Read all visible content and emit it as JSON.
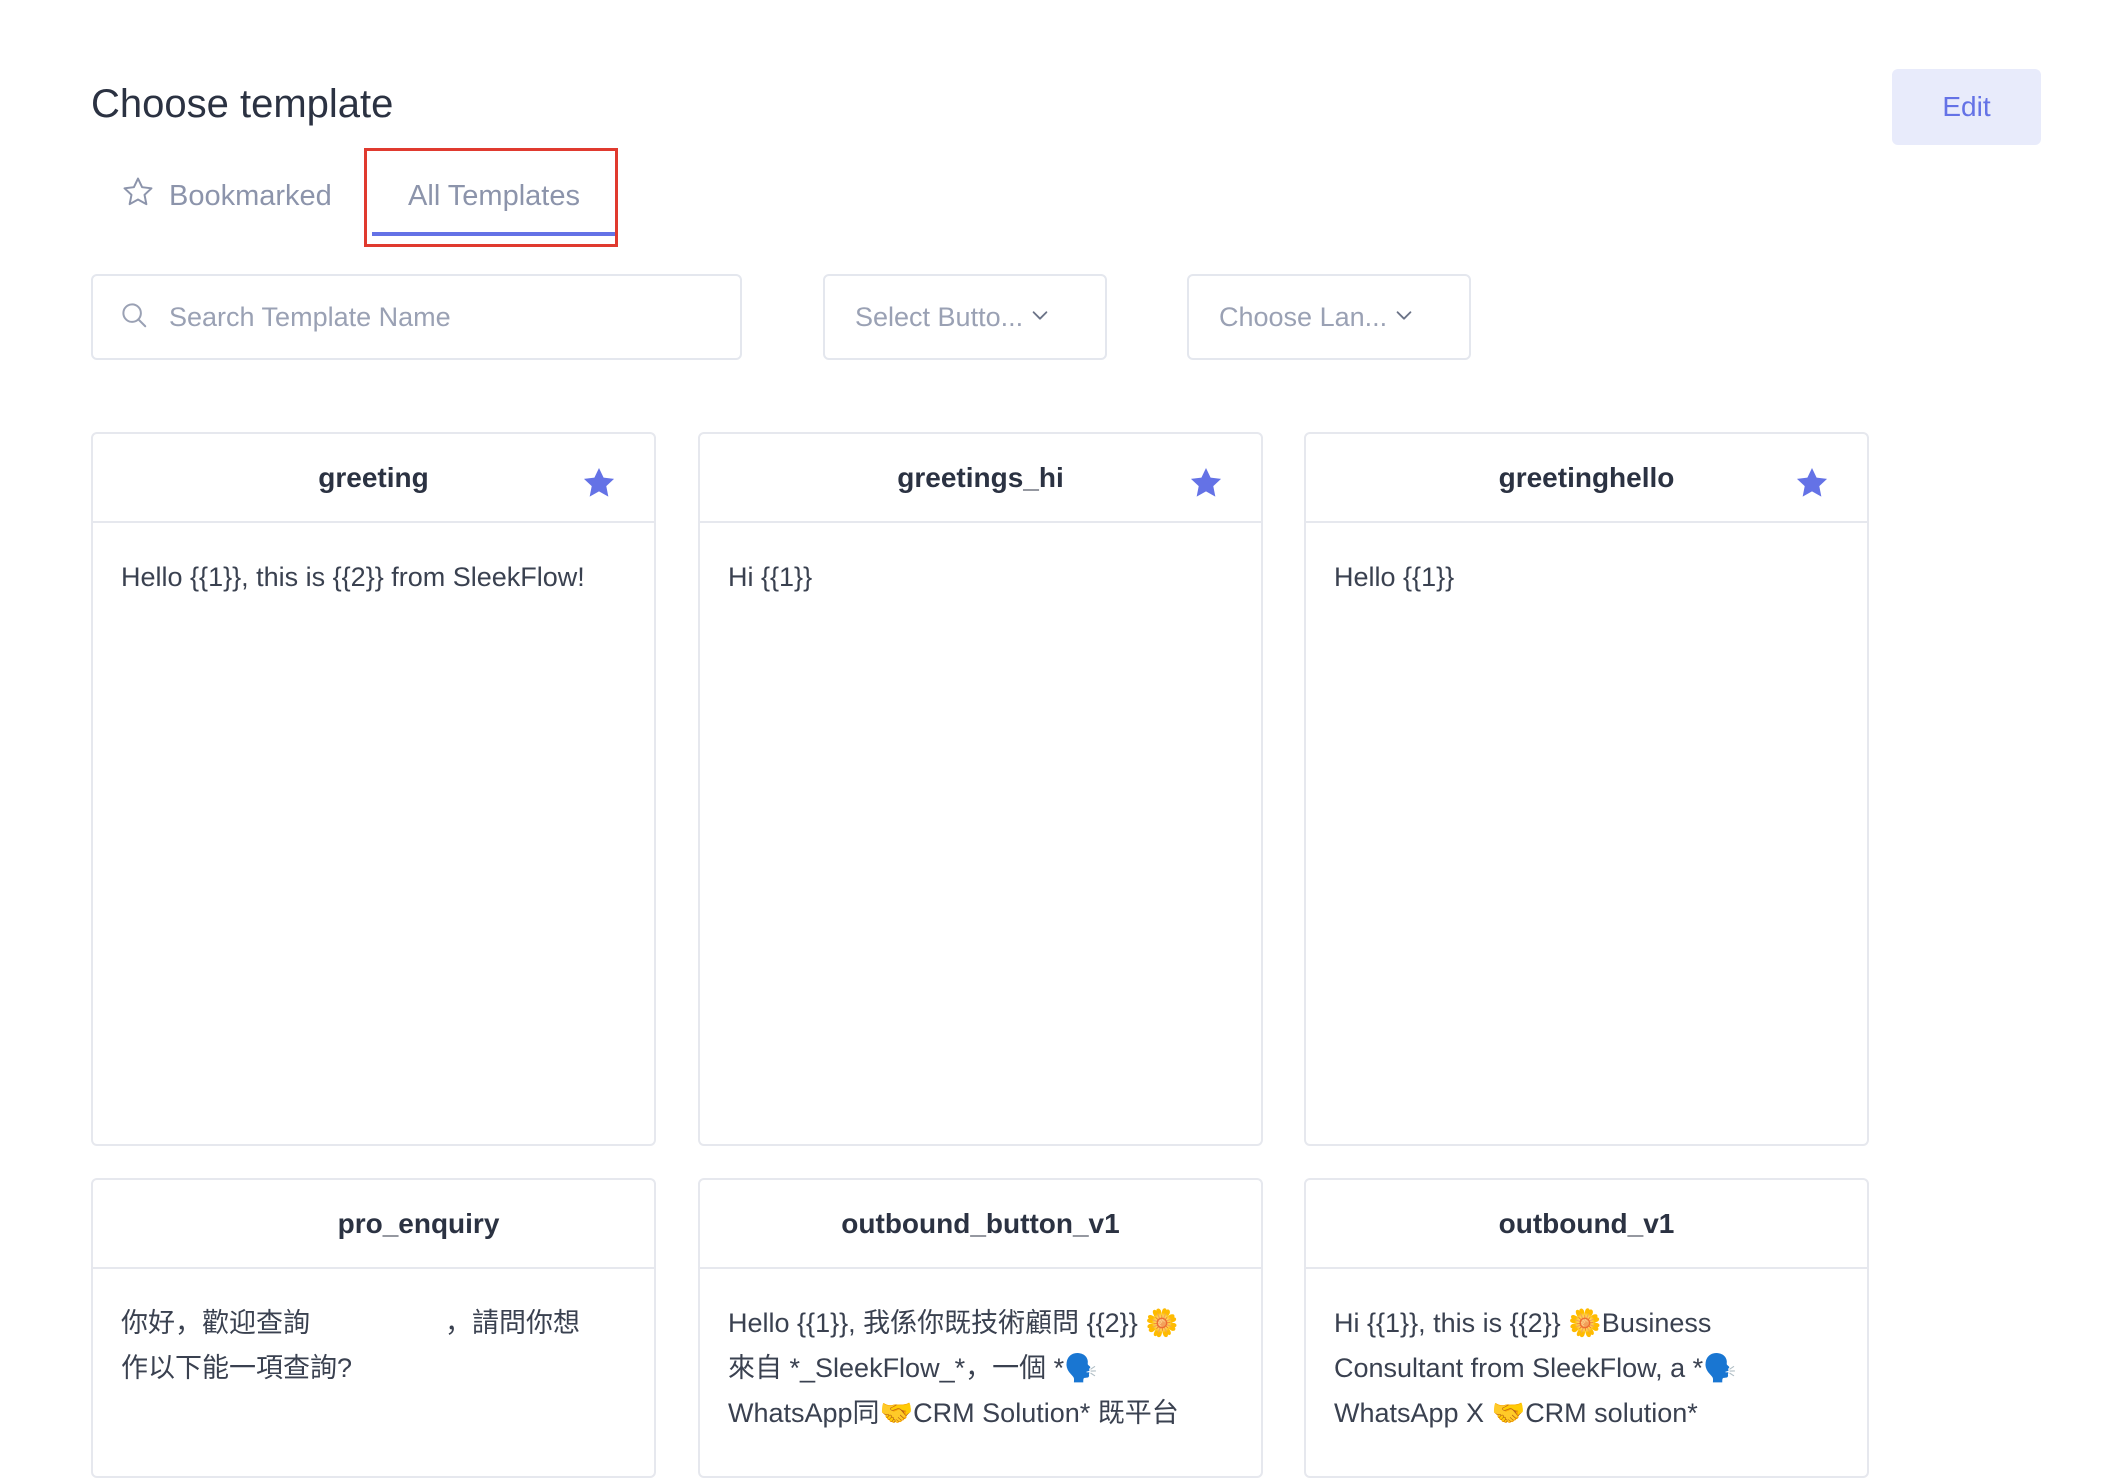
{
  "page": {
    "title": "Choose template",
    "edit_label": "Edit"
  },
  "tabs": [
    {
      "label": "Bookmarked",
      "icon": "star-outline-icon",
      "active": false
    },
    {
      "label": "All Templates",
      "active": true
    }
  ],
  "filters": {
    "search_placeholder": "Search Template Name",
    "button_select": "Select Butto...",
    "language_select": "Choose Lan..."
  },
  "colors": {
    "accent": "#6472e6",
    "highlight": "#e03a2f",
    "star": "#6472e6"
  },
  "templates": [
    {
      "name": "greeting",
      "bookmarked": true,
      "body": "Hello {{1}}, this is {{2}} from SleekFlow!"
    },
    {
      "name": "greetings_hi",
      "bookmarked": true,
      "body": "Hi {{1}}"
    },
    {
      "name": "greetinghello",
      "bookmarked": true,
      "body": "Hello {{1}}"
    },
    {
      "name": "pro_enquiry",
      "bookmarked": false,
      "body": "你好，歡迎查詢　　　　　，請問你想\n作以下能一項查詢?"
    },
    {
      "name": "outbound_button_v1",
      "bookmarked": false,
      "body": "Hello {{1}}, 我係你既技術顧問 {{2}} 🌼\n來自 *_SleekFlow_*，一個 *🗣️\nWhatsApp同🤝CRM Solution* 既平台"
    },
    {
      "name": "outbound_v1",
      "bookmarked": false,
      "body": "Hi {{1}}, this is {{2}} 🌼Business\nConsultant from SleekFlow, a *🗣️\nWhatsApp X 🤝CRM solution*"
    }
  ]
}
